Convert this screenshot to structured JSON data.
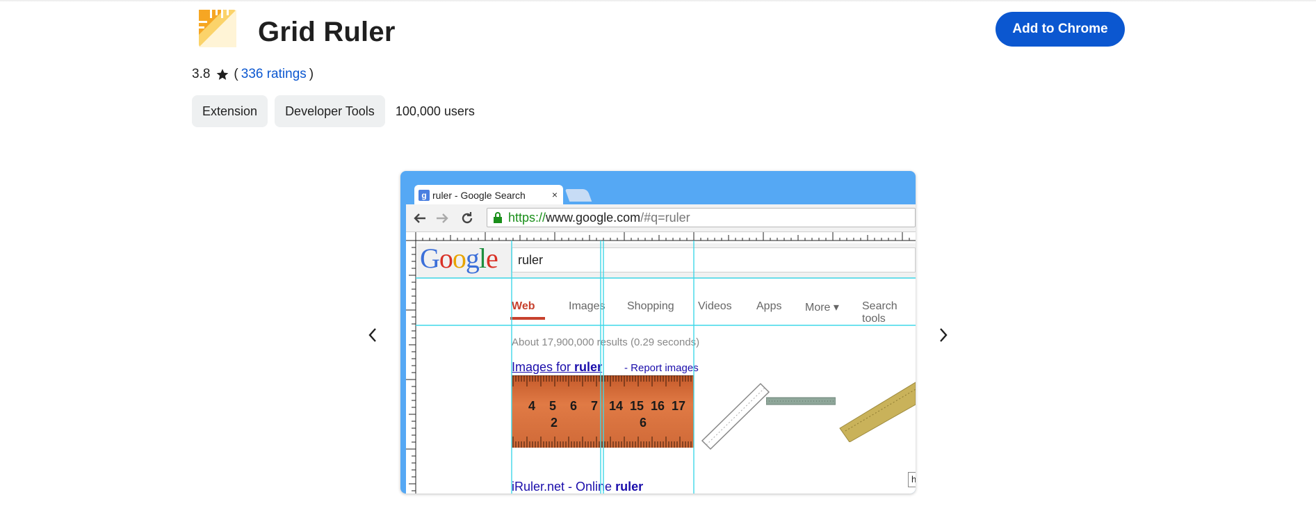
{
  "extension": {
    "title": "Grid Ruler",
    "add_button_label": "Add to Chrome",
    "rating_value": "3.8",
    "ratings_link_text": "336 ratings",
    "paren_open": "(",
    "paren_close": ")",
    "chips": [
      "Extension",
      "Developer Tools"
    ],
    "users": "100,000 users"
  },
  "carousel": {
    "prev_icon": "chevron-left-icon",
    "next_icon": "chevron-right-icon"
  },
  "screenshot": {
    "tab_title": "ruler - Google Search",
    "tab_close": "×",
    "favicon_letter": "g",
    "url_https": "https://",
    "url_domain": "www.google.com",
    "url_rest": "/#q=ruler",
    "search_query": "ruler",
    "logo_letters": [
      "G",
      "o",
      "o",
      "g",
      "l",
      "e"
    ],
    "tabs": [
      "Web",
      "Images",
      "Shopping",
      "Videos",
      "Apps",
      "More ▾",
      "Search tools"
    ],
    "result_stats": "About 17,900,000 results (0.29 seconds)",
    "images_for_prefix": "Images for ",
    "images_for_query": "ruler",
    "report_images": "- Report images",
    "ruler_numbers_left": [
      "4",
      "5",
      "6",
      "7"
    ],
    "ruler_big_left": "2",
    "ruler_numbers_right": [
      "14",
      "15",
      "16",
      "17"
    ],
    "ruler_big_right": "6",
    "iruler_text": "iRuler.net - Online ",
    "iruler_bold": "ruler",
    "tooltip_text": "htt"
  },
  "colors": {
    "accent": "#0b57d0",
    "screenshot_frame": "#55a8f4",
    "guide_lines": "#3fd7e8"
  }
}
